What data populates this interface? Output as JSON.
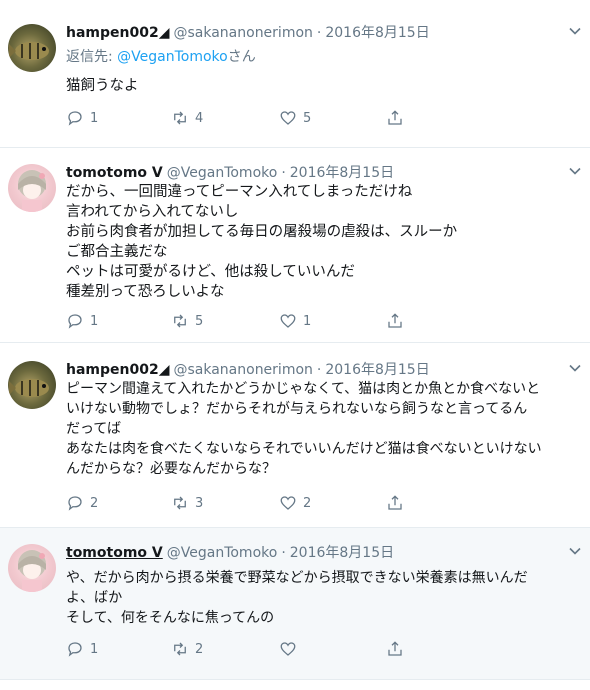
{
  "tweets": [
    {
      "name": "hampen002◢",
      "handle": "@sakananonerimon",
      "dot": "·",
      "date": "2016年8月15日",
      "reply_label": "返信先:",
      "reply_to": "@VeganTomoko",
      "reply_suffix": "さん",
      "lines": [
        "猫飼うなよ"
      ],
      "replies": "1",
      "retweets": "4",
      "likes": "5"
    },
    {
      "name": "tomotomo V",
      "handle": "@VeganTomoko",
      "dot": "·",
      "date": "2016年8月15日",
      "lines": [
        "だから、一回間違ってピーマン入れてしまっただけね",
        "言われてから入れてないし",
        "お前ら肉食者が加担してる毎日の屠殺場の虐殺は、スルーか",
        "ご都合主義だな",
        "ペットは可愛がるけど、他は殺していいんだ",
        "種差別って恐ろしいよな"
      ],
      "replies": "1",
      "retweets": "5",
      "likes": "1"
    },
    {
      "name": "hampen002◢",
      "handle": "@sakananonerimon",
      "dot": "·",
      "date": "2016年8月15日",
      "lines": [
        "ピーマン間違えて入れたかどうかじゃなくて、猫は肉とか魚とか食べないと",
        "いけない動物でしょ？だからそれが与えられないなら飼うなと言ってるん",
        "だってば",
        "あなたは肉を食べたくないならそれでいいんだけど猫は食べないといけない",
        "んだからな？必要なんだからな？"
      ],
      "replies": "2",
      "retweets": "3",
      "likes": "2"
    },
    {
      "name": "tomotomo V",
      "handle": "@VeganTomoko",
      "dot": "·",
      "date": "2016年8月15日",
      "lines": [
        "や、だから肉から摂る栄養で野菜などから摂取できない栄養素は無いんだ",
        "よ、ばか",
        "そして、何をそんなに焦ってんの"
      ],
      "replies": "1",
      "retweets": "2",
      "likes": ""
    }
  ],
  "colors": {
    "text": "#14171a",
    "secondary": "#657786",
    "link": "#1da1f2",
    "highlight_bg": "#f5f8fa"
  }
}
